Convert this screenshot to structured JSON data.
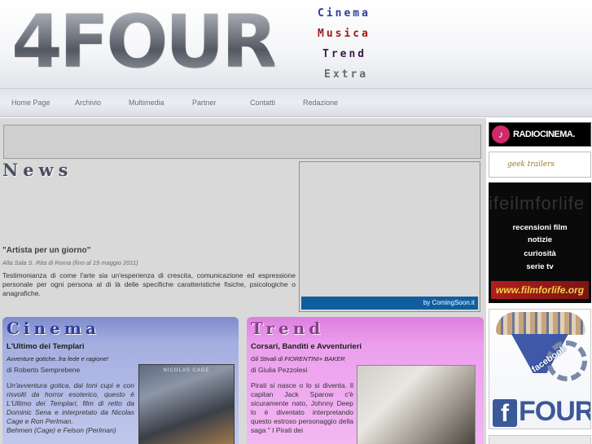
{
  "header": {
    "logo": "4FOUR",
    "categories": [
      {
        "label": "Cinema",
        "color": "#2d3c9a"
      },
      {
        "label": "Musica",
        "color": "#9b1a1a"
      },
      {
        "label": "Trend",
        "color": "#3a1a4e"
      },
      {
        "label": "Extra",
        "color": "#6b6b6b"
      }
    ]
  },
  "nav": [
    "Home Page",
    "Archivio",
    "Multimedia",
    "Partner",
    "Contatti",
    "Redazione"
  ],
  "news": {
    "section_title": "News",
    "headline": "\"Artista per un giorno\"",
    "subtitle": "Alla Sala S. Rita di Roma (fino al 19 maggio 2011)",
    "body": "Testimonianza di come l'arte sia un'esperienza di crescita, comunicazione ed espressione personale per ogni persona al di là delle specifiche caratteristiche fisiche, psicologiche o anagrafiche."
  },
  "video": {
    "credit": "by ComingSoon.it"
  },
  "cinema": {
    "section_title": "Cinema",
    "headline": "L'Ultimo dei Templari",
    "subtitle": "Avventure gotiche..fra fede e ragione!",
    "author": "di Roberto Semprebene",
    "text": "Un'avventura gotica, dai toni cupi e con risvolti da horror esoterico, questo è L'Ultimo dei Templari, film di retto da Dominic Sena e interpretato da Nicolas Cage e Ron Perlman.",
    "text2": "Behmen (Cage) e Felson (Perlman)",
    "poster_text": "NICOLAS CAGE"
  },
  "trend": {
    "section_title": "Trend",
    "headline": "Corsari, Banditi e Avventurieri",
    "subtitle": "Gli Stivali di FIORENTINI+ BAKER",
    "author": "di Giulia Pezzolesi",
    "text": "Pirati si nasce o lo si diventa. Il capitan Jack Sparow c'è sicuramente nato, Johnny Deep lo è diventato interpretando questo estroso personaggio della saga \" I Pirati dei"
  },
  "sidebar": {
    "radio": "RADIOCINEMA.",
    "geek": "geek trailers",
    "filmforlife": {
      "bg_text": "ifeilmforlife",
      "lines": [
        "recensioni film",
        "notizie",
        "curiosità",
        "serie tv"
      ],
      "url": "www.filmforlife.org"
    },
    "facebook": {
      "label": "facebook",
      "brand": "FOUR",
      "f": "f"
    }
  }
}
